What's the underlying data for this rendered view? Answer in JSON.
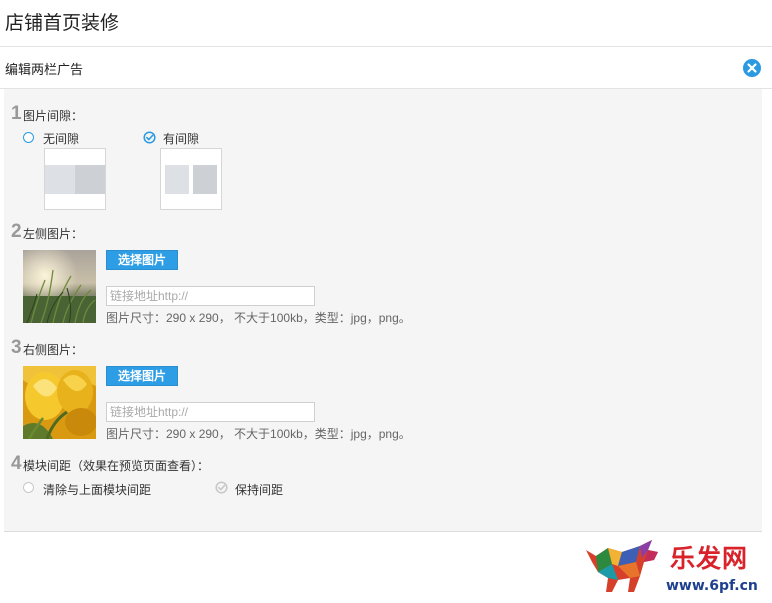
{
  "page": {
    "title": "店铺首页装修"
  },
  "panel": {
    "title": "编辑两栏广告"
  },
  "sections": [
    {
      "num": "1",
      "label": "图片间隙："
    },
    {
      "num": "2",
      "label": "左侧图片："
    },
    {
      "num": "3",
      "label": "右侧图片："
    },
    {
      "num": "4",
      "label": "模块间距（效果在预览页面查看）："
    }
  ],
  "gap_options": [
    {
      "label": "无间隙",
      "selected": false
    },
    {
      "label": "有间隙",
      "selected": true
    }
  ],
  "left_image": {
    "button_label": "选择图片",
    "link_placeholder": "链接地址http://",
    "hint": "图片尺寸：290 x 290， 不大于100kb，类型：jpg，png。"
  },
  "right_image": {
    "button_label": "选择图片",
    "link_placeholder": "链接地址http://",
    "hint": "图片尺寸：290 x 290， 不大于100kb，类型：jpg，png。"
  },
  "spacing_options": [
    {
      "label": "清除与上面模块间距",
      "selected": false
    },
    {
      "label": "保持间距",
      "selected": true
    }
  ],
  "watermark": {
    "brand": "乐发网",
    "url": "www.6pf.cn"
  },
  "colors": {
    "accent": "#2b9ae0",
    "button": "#2d9de6",
    "panel_bg": "#f5f5f5"
  }
}
